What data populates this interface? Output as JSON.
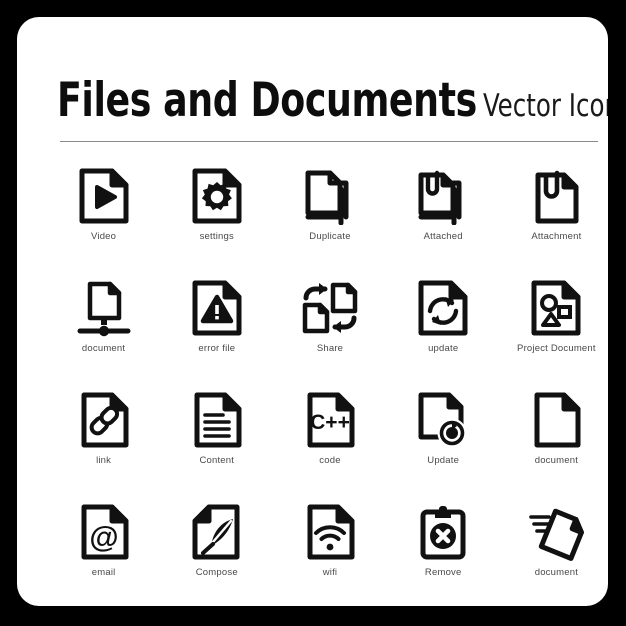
{
  "header": {
    "title_main": "Files and Documents",
    "title_sub": "Vector Icons"
  },
  "colors": {
    "background": "#000000",
    "card": "#ffffff",
    "icon_stroke": "#111111",
    "label_text": "#4a4a4a",
    "rule": "#8a8a8a"
  },
  "icons": [
    {
      "label": "Video",
      "icon": "file-video-play-icon"
    },
    {
      "label": "settings",
      "icon": "file-settings-gear-icon"
    },
    {
      "label": "Duplicate",
      "icon": "file-duplicate-stack-icon"
    },
    {
      "label": "Attached",
      "icon": "file-attached-stack-clip-icon"
    },
    {
      "label": "Attachment",
      "icon": "file-attachment-clip-icon"
    },
    {
      "label": "document",
      "icon": "file-network-node-icon"
    },
    {
      "label": "error file",
      "icon": "file-error-warning-icon"
    },
    {
      "label": "Share",
      "icon": "file-share-arrows-icon"
    },
    {
      "label": "update",
      "icon": "file-update-refresh-icon"
    },
    {
      "label": "Project Document",
      "icon": "file-project-shapes-icon"
    },
    {
      "label": "link",
      "icon": "file-link-chain-icon"
    },
    {
      "label": "Content",
      "icon": "file-content-lines-icon"
    },
    {
      "label": "code",
      "icon": "file-code-cpp-icon"
    },
    {
      "label": "Update",
      "icon": "file-update-badge-icon"
    },
    {
      "label": "document",
      "icon": "file-blank-icon"
    },
    {
      "label": "email",
      "icon": "file-email-at-icon"
    },
    {
      "label": "Compose",
      "icon": "file-compose-quill-icon"
    },
    {
      "label": "wifi",
      "icon": "file-wifi-signal-icon"
    },
    {
      "label": "Remove",
      "icon": "clipboard-remove-cross-icon"
    },
    {
      "label": "document",
      "icon": "file-send-tilted-icon"
    }
  ]
}
